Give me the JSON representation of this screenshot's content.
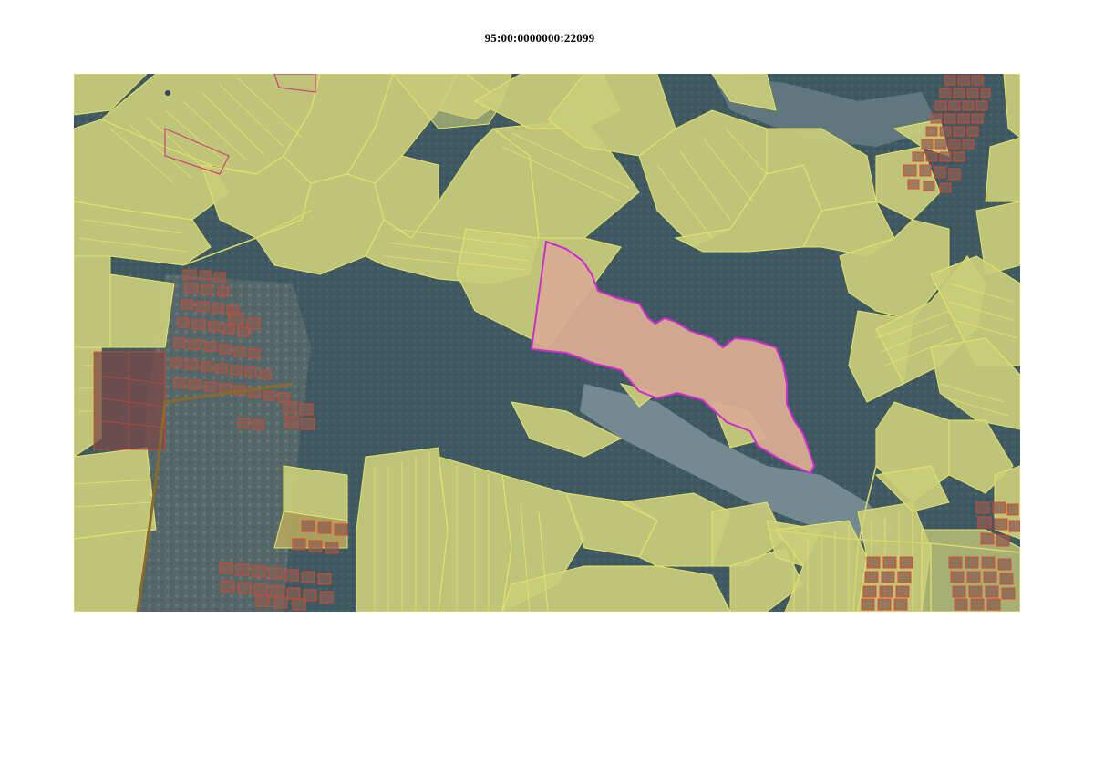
{
  "document": {
    "cadastral_number": "95:00:0000000:22099"
  },
  "map": {
    "colors": {
      "background_forest": "#3f5a63",
      "forest_dark": "#36505a",
      "field_fill": "#c9cd7a",
      "field_fill_alt": "#bcc472",
      "field_border": "#e8e46a",
      "settlement_lot_border": "#e0452a",
      "settlement_lot_fill": "#9a6a58",
      "highlight_parcel_fill": "#d8ad92",
      "highlight_parcel_border": "#d02ad0",
      "admin_boundary": "#8a6a2a",
      "ravine_light": "#8d9ea2"
    }
  }
}
